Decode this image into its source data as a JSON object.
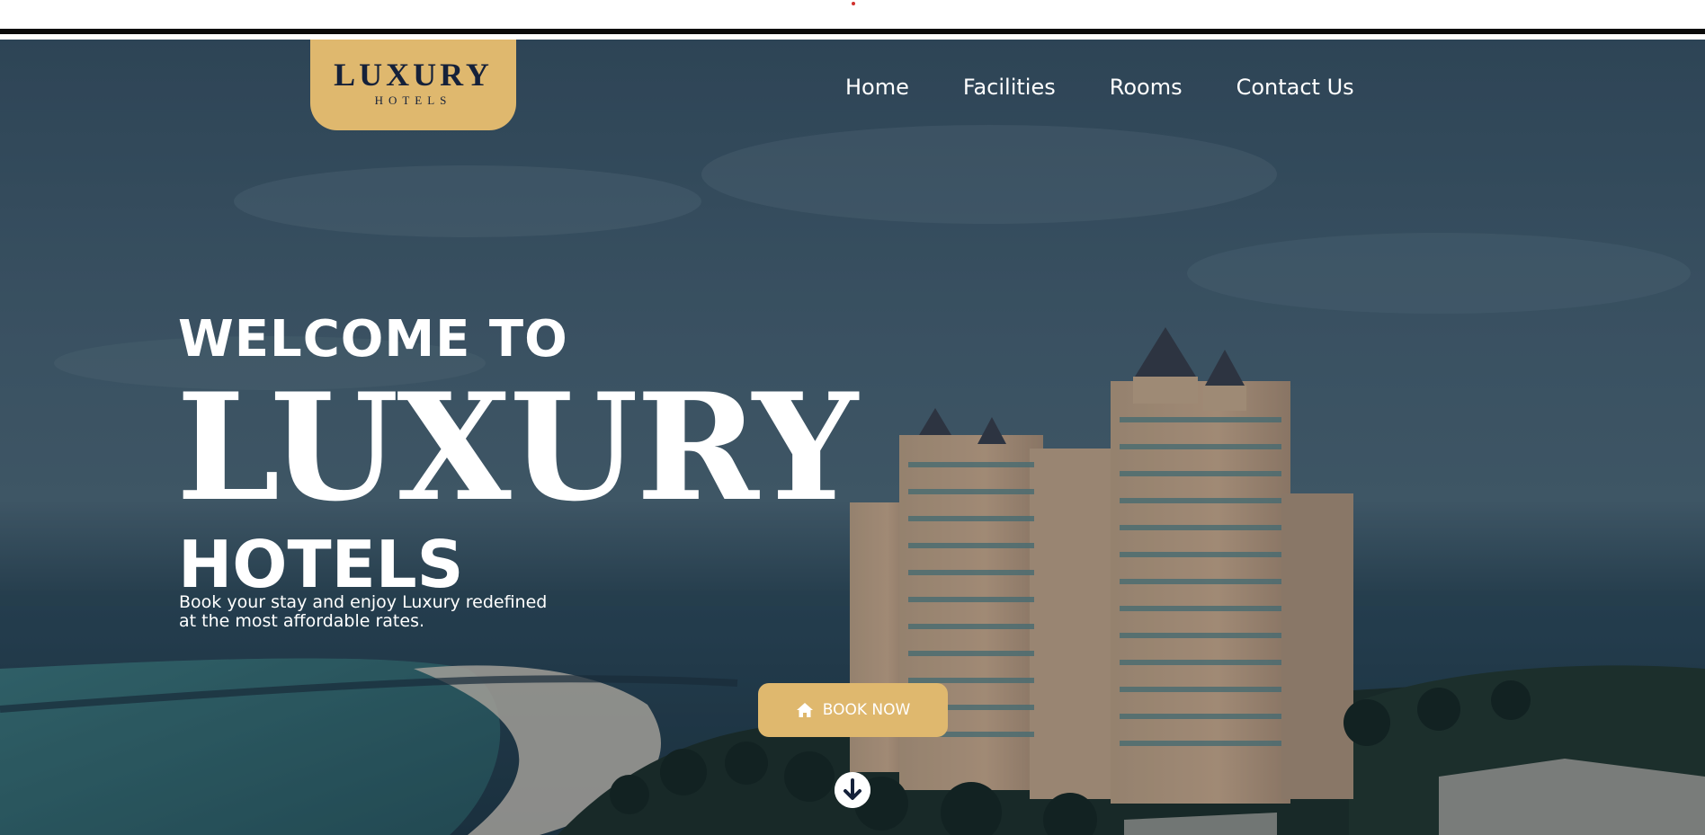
{
  "brand": {
    "logo_main": "LUXURY",
    "logo_sub": "HOTELS"
  },
  "nav": {
    "items": [
      "Home",
      "Facilities",
      "Rooms",
      "Contact Us"
    ]
  },
  "hero": {
    "welcome": "WELCOME TO",
    "title": "LUXURY",
    "subtitle": "HOTELS",
    "tagline": "Book your stay and enjoy Luxury redefined at the most affordable rates.",
    "cta_label": "BOOK NOW",
    "cta_icon": "home-icon",
    "scroll_icon": "arrow-down-circle-icon"
  },
  "colors": {
    "accent": "#dfb86e",
    "logo_text": "#15213a",
    "text": "#ffffff"
  }
}
